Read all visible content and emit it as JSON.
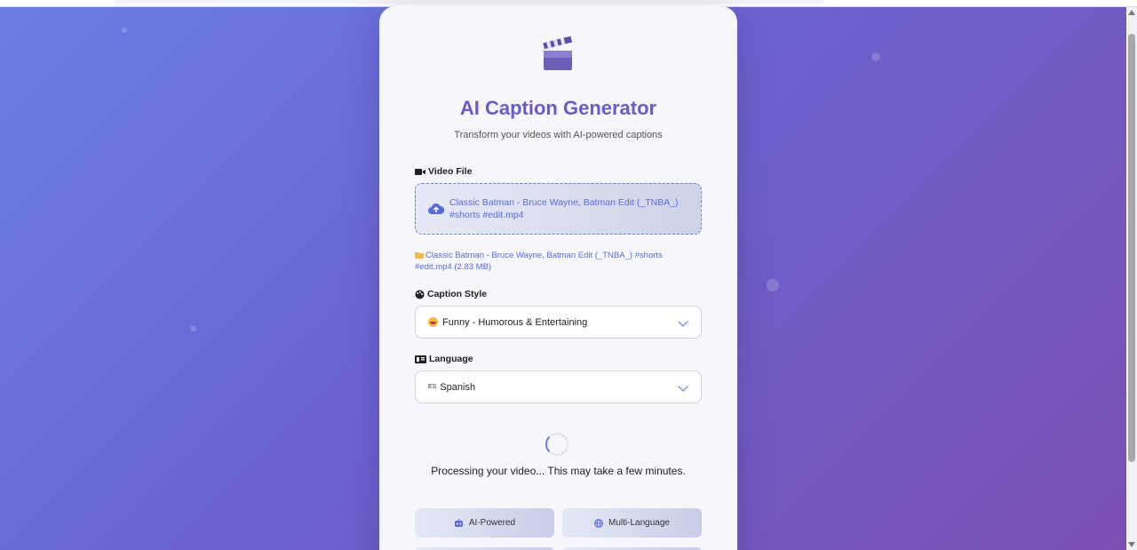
{
  "app": {
    "title": "AI Caption Generator",
    "subtitle": "Transform your videos with AI-powered captions",
    "logo_icon": "clapperboard-icon"
  },
  "video_file": {
    "label": "Video File",
    "label_icon": "video-camera-icon",
    "selected_file": "Classic Batman - Bruce Wayne, Batman Edit (_TNBA_) #shorts #edit.mp4",
    "file_info": "Classic Batman - Bruce Wayne, Batman Edit (_TNBA_) #shorts #edit.mp4 (2.83 MB)",
    "upload_icon": "cloud-upload-icon",
    "folder_icon": "folder-icon"
  },
  "caption_style": {
    "label": "Caption Style",
    "label_icon": "palette-icon",
    "selected": "Funny - Humorous & Entertaining",
    "selected_icon": "laughing-emoji-icon"
  },
  "language": {
    "label": "Language",
    "label_icon": "language-icon",
    "flag_text": "ES",
    "selected": "Spanish"
  },
  "status": {
    "message": "Processing your video... This may take a few minutes."
  },
  "features": [
    {
      "label": "AI-Powered",
      "icon": "robot-icon"
    },
    {
      "label": "Multi-Language",
      "icon": "globe-icon"
    }
  ],
  "colors": {
    "accent": "#5a6cd8",
    "title": "#6a5cc8",
    "background_start": "#6a7fe6",
    "background_end": "#7a4fb0"
  }
}
